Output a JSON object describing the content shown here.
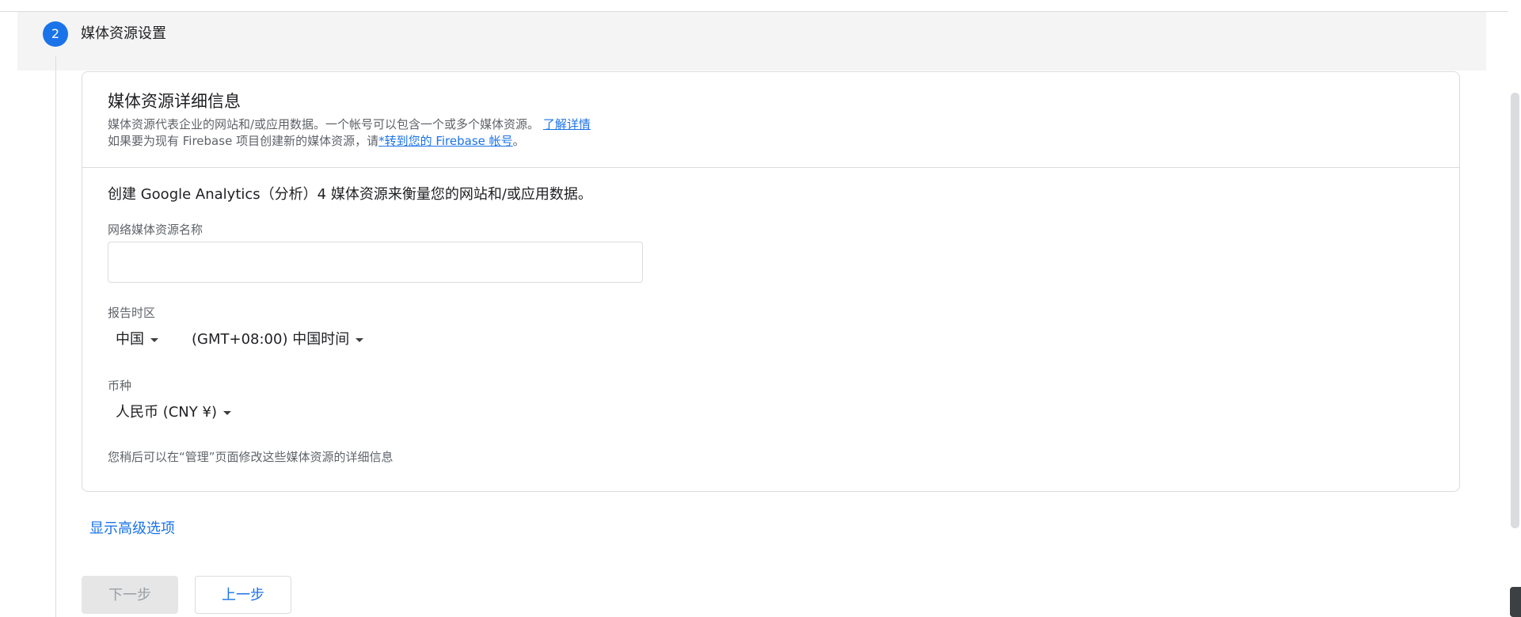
{
  "step": {
    "number": "2",
    "title": "媒体资源设置"
  },
  "card": {
    "title": "媒体资源详细信息",
    "desc_line1": "媒体资源代表企业的网站和/或应用数据。一个帐号可以包含一个或多个媒体资源。",
    "learn_more_link": "了解详情",
    "desc_line2_prefix": "如果要为现有 Firebase 项目创建新的媒体资源，请",
    "firebase_link": "*转到您的 Firebase 帐号",
    "desc_line2_suffix": "。",
    "create_text": "创建 Google Analytics（分析）4 媒体资源来衡量您的网站和/或应用数据。",
    "name_label": "网络媒体资源名称",
    "name_value": "",
    "timezone_label": "报告时区",
    "country_value": "中国",
    "timezone_value": "(GMT+08:00) 中国时间",
    "currency_label": "币种",
    "currency_value": "人民币 (CNY ¥)",
    "note": "您稍后可以在“管理”页面修改这些媒体资源的详细信息"
  },
  "advanced_link": "显示高级选项",
  "buttons": {
    "next": "下一步",
    "back": "上一步"
  }
}
